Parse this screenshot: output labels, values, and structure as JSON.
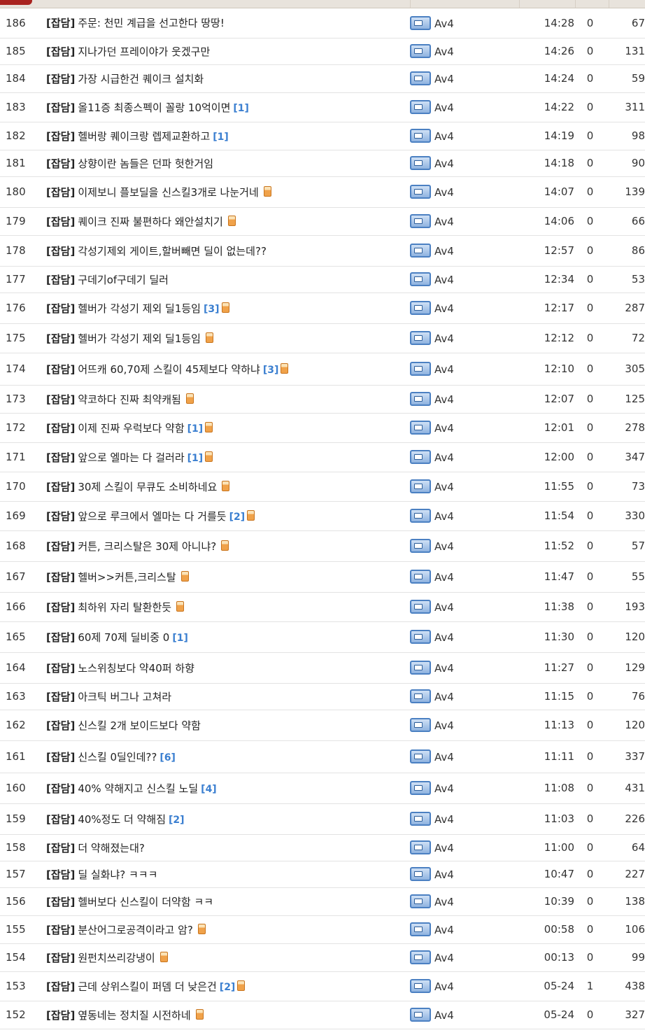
{
  "colors": {
    "accent_tab": "#a9231f",
    "comment_count": "#3b7fd0",
    "image_icon": "#f0a24a",
    "level_icon": "#4b80c2"
  },
  "icons": {
    "attachment": "image-attachment-icon",
    "level": "level-badge-icon"
  },
  "rows": [
    {
      "num": "186",
      "cat": "[잡담]",
      "title": "주문: 천민 계급을 선고한다 땅땅!",
      "ccount": "",
      "img": false,
      "author": "Av4",
      "time": "14:28",
      "comments": "0",
      "views": "67"
    },
    {
      "num": "185",
      "cat": "[잡담]",
      "title": "지나가던 프레이야가 웃겠구만",
      "ccount": "",
      "img": false,
      "author": "Av4",
      "time": "14:26",
      "comments": "0",
      "views": "131"
    },
    {
      "num": "184",
      "cat": "[잡담]",
      "title": "가장 시급한건 퀘이크 설치화",
      "ccount": "",
      "img": false,
      "author": "Av4",
      "time": "14:24",
      "comments": "0",
      "views": "59"
    },
    {
      "num": "183",
      "cat": "[잡담]",
      "title": "올11증 최종스펙이 꼴랑 10억이면",
      "ccount": "[1]",
      "img": false,
      "author": "Av4",
      "time": "14:22",
      "comments": "0",
      "views": "311"
    },
    {
      "num": "182",
      "cat": "[잡담]",
      "title": "헬버랑 퀘이크랑 렙제교환하고",
      "ccount": "[1]",
      "img": false,
      "author": "Av4",
      "time": "14:19",
      "comments": "0",
      "views": "98"
    },
    {
      "num": "181",
      "cat": "[잡담]",
      "title": "상향이란 놈들은 던파 헛한거임",
      "ccount": "",
      "img": false,
      "author": "Av4",
      "time": "14:18",
      "comments": "0",
      "views": "90"
    },
    {
      "num": "180",
      "cat": "[잡담]",
      "title": "이제보니 플보딜을 신스킬3개로 나눈거네",
      "ccount": "",
      "img": true,
      "author": "Av4",
      "time": "14:07",
      "comments": "0",
      "views": "139"
    },
    {
      "num": "179",
      "cat": "[잡담]",
      "title": "퀘이크 진짜 불편하다 왜안설치기",
      "ccount": "",
      "img": true,
      "author": "Av4",
      "time": "14:06",
      "comments": "0",
      "views": "66"
    },
    {
      "num": "178",
      "cat": "[잡담]",
      "title": "각성기제외 게이트,할버빼면 딜이 없는데??",
      "ccount": "",
      "img": false,
      "author": "Av4",
      "time": "12:57",
      "comments": "0",
      "views": "86"
    },
    {
      "num": "177",
      "cat": "[잡담]",
      "title": "구데기of구데기 딜러",
      "ccount": "",
      "img": false,
      "author": "Av4",
      "time": "12:34",
      "comments": "0",
      "views": "53"
    },
    {
      "num": "176",
      "cat": "[잡담]",
      "title": "헬버가 각성기 제외 딜1등임",
      "ccount": "[3]",
      "img": true,
      "author": "Av4",
      "time": "12:17",
      "comments": "0",
      "views": "287"
    },
    {
      "num": "175",
      "cat": "[잡담]",
      "title": "헬버가 각성기 제외 딜1등임",
      "ccount": "",
      "img": true,
      "author": "Av4",
      "time": "12:12",
      "comments": "0",
      "views": "72"
    },
    {
      "num": "174",
      "cat": "[잡담]",
      "title": "어뜨캐 60,70제 스킬이 45제보다 약하냐",
      "ccount": "[3]",
      "img": true,
      "author": "Av4",
      "time": "12:10",
      "comments": "0",
      "views": "305"
    },
    {
      "num": "173",
      "cat": "[잡담]",
      "title": "약코하다 진짜 최약캐됨",
      "ccount": "",
      "img": true,
      "author": "Av4",
      "time": "12:07",
      "comments": "0",
      "views": "125"
    },
    {
      "num": "172",
      "cat": "[잡담]",
      "title": "이제 진짜 우럭보다 약함",
      "ccount": "[1]",
      "img": true,
      "author": "Av4",
      "time": "12:01",
      "comments": "0",
      "views": "278"
    },
    {
      "num": "171",
      "cat": "[잡담]",
      "title": "앞으로 엘마는 다 걸러라",
      "ccount": "[1]",
      "img": true,
      "author": "Av4",
      "time": "12:00",
      "comments": "0",
      "views": "347"
    },
    {
      "num": "170",
      "cat": "[잡담]",
      "title": "30제 스킬이 무큐도 소비하네요",
      "ccount": "",
      "img": true,
      "author": "Av4",
      "time": "11:55",
      "comments": "0",
      "views": "73"
    },
    {
      "num": "169",
      "cat": "[잡담]",
      "title": "앞으로 루크에서 엘마는 다 거를듯",
      "ccount": "[2]",
      "img": true,
      "author": "Av4",
      "time": "11:54",
      "comments": "0",
      "views": "330"
    },
    {
      "num": "168",
      "cat": "[잡담]",
      "title": "커튼, 크리스탈은 30제 아니냐?",
      "ccount": "",
      "img": true,
      "author": "Av4",
      "time": "11:52",
      "comments": "0",
      "views": "57"
    },
    {
      "num": "167",
      "cat": "[잡담]",
      "title": "헬버>>커튼,크리스탈",
      "ccount": "",
      "img": true,
      "author": "Av4",
      "time": "11:47",
      "comments": "0",
      "views": "55"
    },
    {
      "num": "166",
      "cat": "[잡담]",
      "title": "최하위 자리 탈환한듯",
      "ccount": "",
      "img": true,
      "author": "Av4",
      "time": "11:38",
      "comments": "0",
      "views": "193"
    },
    {
      "num": "165",
      "cat": "[잡담]",
      "title": "60제 70제 딜비중 0",
      "ccount": "[1]",
      "img": false,
      "author": "Av4",
      "time": "11:30",
      "comments": "0",
      "views": "120"
    },
    {
      "num": "164",
      "cat": "[잡담]",
      "title": "노스위칭보다 약40퍼 하향",
      "ccount": "",
      "img": false,
      "author": "Av4",
      "time": "11:27",
      "comments": "0",
      "views": "129"
    },
    {
      "num": "163",
      "cat": "[잡담]",
      "title": "아크틱 버그나 고쳐라",
      "ccount": "",
      "img": false,
      "author": "Av4",
      "time": "11:15",
      "comments": "0",
      "views": "76"
    },
    {
      "num": "162",
      "cat": "[잡담]",
      "title": "신스킬 2개 보이드보다 약함",
      "ccount": "",
      "img": false,
      "author": "Av4",
      "time": "11:13",
      "comments": "0",
      "views": "120"
    },
    {
      "num": "161",
      "cat": "[잡담]",
      "title": "신스킬 0딜인데??",
      "ccount": "[6]",
      "img": false,
      "author": "Av4",
      "time": "11:11",
      "comments": "0",
      "views": "337"
    },
    {
      "num": "160",
      "cat": "[잡담]",
      "title": "40% 약해지고 신스킬 노딜",
      "ccount": "[4]",
      "img": false,
      "author": "Av4",
      "time": "11:08",
      "comments": "0",
      "views": "431"
    },
    {
      "num": "159",
      "cat": "[잡담]",
      "title": "40%정도 더 약해짐",
      "ccount": "[2]",
      "img": false,
      "author": "Av4",
      "time": "11:03",
      "comments": "0",
      "views": "226"
    },
    {
      "num": "158",
      "cat": "[잡담]",
      "title": "더 약해졌는대?",
      "ccount": "",
      "img": false,
      "author": "Av4",
      "time": "11:00",
      "comments": "0",
      "views": "64"
    },
    {
      "num": "157",
      "cat": "[잡담]",
      "title": "딜 실화냐? ㅋㅋㅋ",
      "ccount": "",
      "img": false,
      "author": "Av4",
      "time": "10:47",
      "comments": "0",
      "views": "227"
    },
    {
      "num": "156",
      "cat": "[잡담]",
      "title": "헬버보다 신스킬이 더약함 ㅋㅋ",
      "ccount": "",
      "img": false,
      "author": "Av4",
      "time": "10:39",
      "comments": "0",
      "views": "138"
    },
    {
      "num": "155",
      "cat": "[잡담]",
      "title": "분산어그로공격이라고 암?",
      "ccount": "",
      "img": true,
      "author": "Av4",
      "time": "00:58",
      "comments": "0",
      "views": "106"
    },
    {
      "num": "154",
      "cat": "[잡담]",
      "title": "원펀치쓰리강냉이",
      "ccount": "",
      "img": true,
      "author": "Av4",
      "time": "00:13",
      "comments": "0",
      "views": "99"
    },
    {
      "num": "153",
      "cat": "[잡담]",
      "title": "근데 상위스킬이 퍼뎀 더 낮은건",
      "ccount": "[2]",
      "img": true,
      "author": "Av4",
      "time": "05-24",
      "comments": "1",
      "views": "438"
    },
    {
      "num": "152",
      "cat": "[잡담]",
      "title": "옆동네는 정치질 시전하네",
      "ccount": "",
      "img": true,
      "author": "Av4",
      "time": "05-24",
      "comments": "0",
      "views": "327"
    }
  ]
}
